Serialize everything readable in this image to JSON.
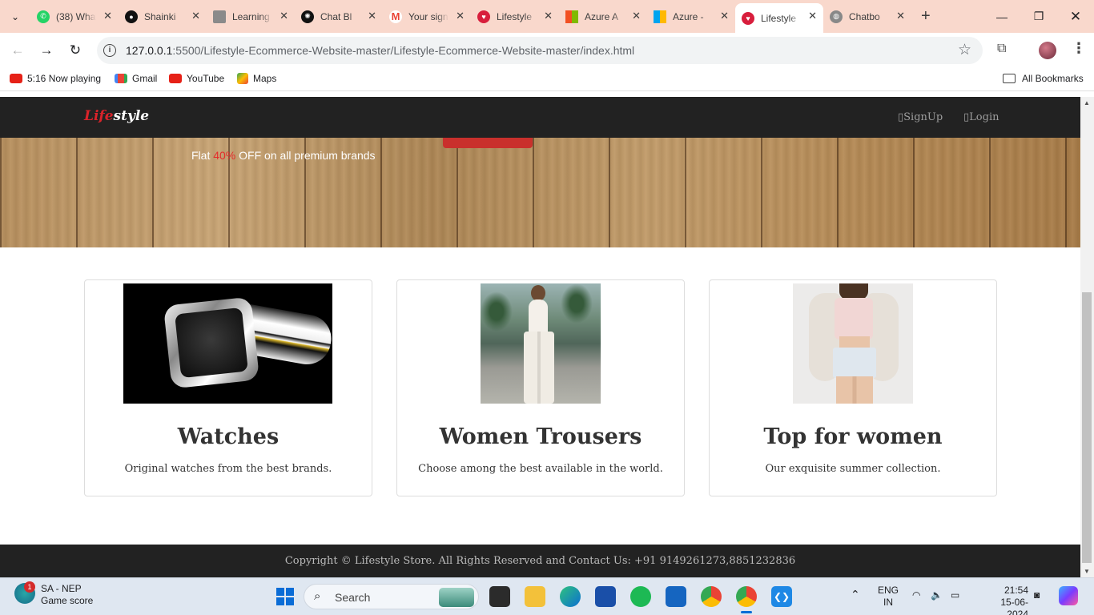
{
  "browser": {
    "tabs": [
      {
        "label": "(38) WhatsApp",
        "favicon": "whatsapp-icon",
        "color": "#25d366"
      },
      {
        "label": "Shainki",
        "favicon": "github-icon",
        "color": "#111111"
      },
      {
        "label": "Learning",
        "favicon": "learning-icon",
        "color": "#6b6b6b"
      },
      {
        "label": "Chat Bl",
        "favicon": "chatgpt-icon",
        "color": "#111111"
      },
      {
        "label": "Your sign",
        "favicon": "gmail-icon",
        "color": "#ea4335"
      },
      {
        "label": "Lifestyle",
        "favicon": "lifestyle-icon",
        "color": "#d81e3c"
      },
      {
        "label": "Azure A",
        "favicon": "microsoft-icon",
        "color": "#f25022"
      },
      {
        "label": "Azure -",
        "favicon": "microsoft-icon",
        "color": "#f25022"
      },
      {
        "label": "Lifestyle",
        "favicon": "lifestyle-icon",
        "color": "#d81e3c",
        "active": true
      },
      {
        "label": "Chatbo",
        "favicon": "globe-icon",
        "color": "#777777"
      }
    ],
    "url_host": "127.0.0.1",
    "url_rest": ":5500/Lifestyle-Ecommerce-Website-master/Lifestyle-Ecommerce-Website-master/index.html",
    "bookmarks": [
      {
        "label": "5:16 Now playing",
        "icon": "youtube-icon"
      },
      {
        "label": "Gmail",
        "icon": "gmail-icon"
      },
      {
        "label": "YouTube",
        "icon": "youtube-icon"
      },
      {
        "label": "Maps",
        "icon": "maps-icon"
      }
    ],
    "all_bookmarks": "All Bookmarks"
  },
  "site": {
    "brand_red": "Life",
    "brand_white": "style",
    "nav": {
      "signup": "SignUp",
      "login": "Login"
    },
    "hero": {
      "prefix": "Flat ",
      "percent": "40%",
      "suffix": " OFF on all premium brands"
    },
    "cards": [
      {
        "title": "Watches",
        "text": "Original watches from the best brands."
      },
      {
        "title": "Women Trousers",
        "text": "Choose among the best available in the world."
      },
      {
        "title": "Top for women",
        "text": "Our exquisite summer collection."
      }
    ],
    "footer": "Copyright © Lifestyle Store. All Rights Reserved and Contact Us: +91 9149261273,8851232836"
  },
  "taskbar": {
    "weather_title": "SA - NEP",
    "weather_sub": "Game score",
    "badge": "1",
    "search_placeholder": "Search",
    "lang_1": "ENG",
    "lang_2": "IN",
    "time": "21:54",
    "date": "15-06-2024"
  },
  "colors": {
    "accent_red": "#d9232a",
    "navbar": "#222222",
    "tabstrip": "#f9d8cc"
  }
}
